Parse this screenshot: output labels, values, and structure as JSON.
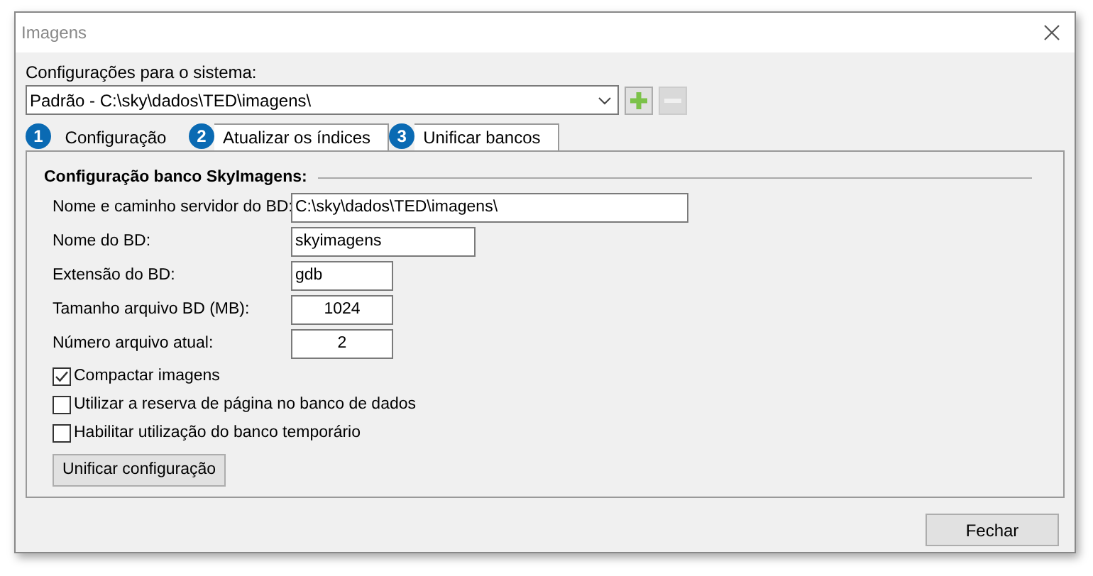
{
  "window": {
    "title": "Imagens"
  },
  "system_config": {
    "label": "Configurações para o sistema:",
    "value": "Padrão - C:\\sky\\dados\\TED\\imagens\\",
    "add_disabled": false,
    "remove_disabled": true
  },
  "tabs": [
    {
      "badge": "1",
      "label": "Configuração",
      "selected": true
    },
    {
      "badge": "2",
      "label": "Atualizar os índices",
      "selected": false
    },
    {
      "badge": "3",
      "label": "Unificar bancos",
      "selected": false
    }
  ],
  "group": {
    "title": "Configuração banco SkyImagens:"
  },
  "fields": [
    {
      "label": "Nome e caminho servidor do BD:",
      "value": "C:\\sky\\dados\\TED\\imagens\\",
      "kind": "text"
    },
    {
      "label": "Nome do BD:",
      "value": "skyimagens",
      "kind": "text"
    },
    {
      "label": "Extensão do BD:",
      "value": "gdb",
      "kind": "text"
    },
    {
      "label": "Tamanho arquivo BD (MB):",
      "value": "1024",
      "kind": "number"
    },
    {
      "label": "Número arquivo atual:",
      "value": "2",
      "kind": "number"
    }
  ],
  "checkboxes": [
    {
      "label": "Compactar imagens",
      "checked": true
    },
    {
      "label": "Utilizar a reserva de página no banco de dados",
      "checked": false
    },
    {
      "label": "Habilitar utilização do banco temporário",
      "checked": false
    }
  ],
  "unify_button": "Unificar configuração",
  "close_button": "Fechar"
}
